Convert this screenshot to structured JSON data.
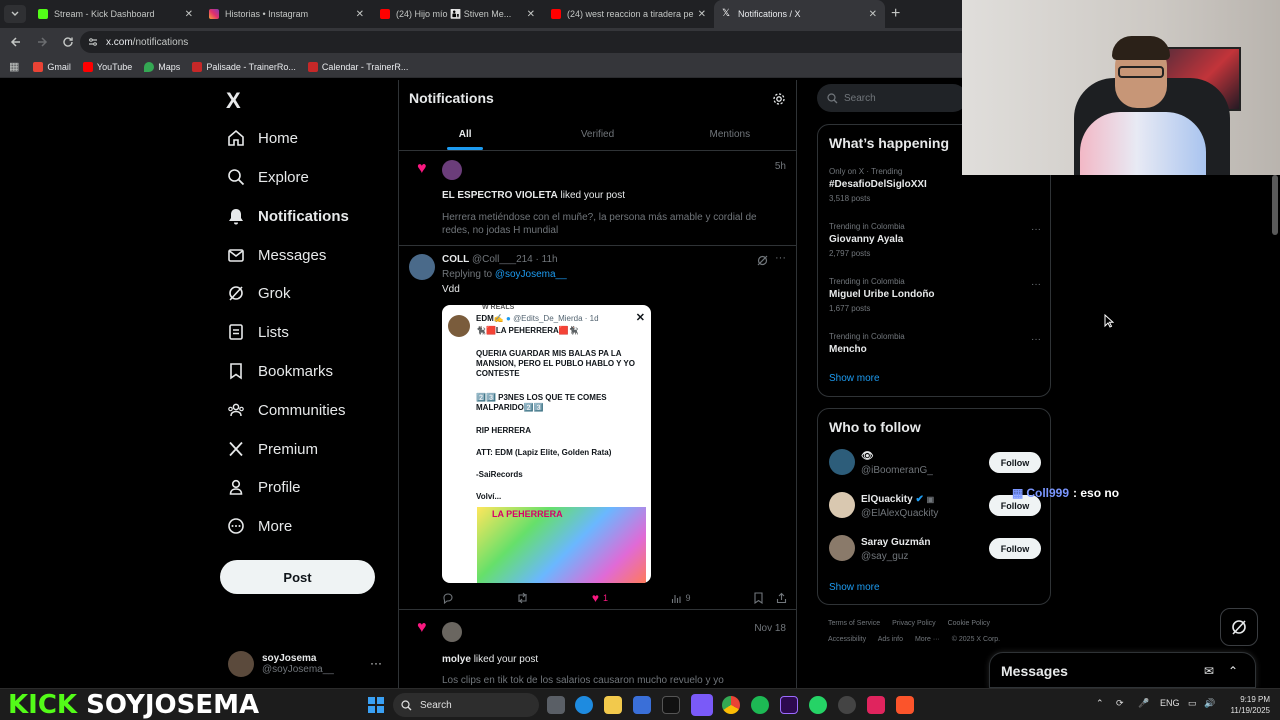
{
  "browser": {
    "tabs": [
      {
        "title": "Stream - Kick Dashboard",
        "favicon_color": "#53fc18",
        "active": false
      },
      {
        "title": "Historias • Instagram",
        "favicon_color": "#e1306c",
        "active": false
      },
      {
        "title": "(24) Hijo mío 👨‍👦 Stiven Me...",
        "favicon_color": "#ff0000",
        "active": false
      },
      {
        "title": "(24) west reaccion a tiradera pe...",
        "favicon_color": "#ff0000",
        "active": false
      },
      {
        "title": "Notifications / X",
        "favicon_color": "#ffffff",
        "active": true
      }
    ],
    "url_domain": "x.com",
    "url_path": "/notifications",
    "bookmarks": [
      {
        "label": "Gmail",
        "color": "#ea4335"
      },
      {
        "label": "YouTube",
        "color": "#ff0000"
      },
      {
        "label": "Maps",
        "color": "#34a853"
      },
      {
        "label": "Palisade - TrainerRo...",
        "color": "#c62828"
      },
      {
        "label": "Calendar - TrainerR...",
        "color": "#c62828"
      }
    ]
  },
  "nav": {
    "logo": "X",
    "items": [
      {
        "label": "Home",
        "icon": "home-icon"
      },
      {
        "label": "Explore",
        "icon": "search-icon"
      },
      {
        "label": "Notifications",
        "icon": "bell-icon"
      },
      {
        "label": "Messages",
        "icon": "mail-icon"
      },
      {
        "label": "Grok",
        "icon": "grok-icon"
      },
      {
        "label": "Lists",
        "icon": "list-icon"
      },
      {
        "label": "Bookmarks",
        "icon": "bookmark-icon"
      },
      {
        "label": "Communities",
        "icon": "people-icon"
      },
      {
        "label": "Premium",
        "icon": "x-icon"
      },
      {
        "label": "Profile",
        "icon": "user-icon"
      },
      {
        "label": "More",
        "icon": "more-circle-icon"
      }
    ],
    "post_button": "Post",
    "account": {
      "name": "soyJosema",
      "handle": "@soyJosema__"
    }
  },
  "main": {
    "title": "Notifications",
    "tabs": [
      "All",
      "Verified",
      "Mentions"
    ],
    "notif1": {
      "time": "5h",
      "actor": "EL ESPECTRO VIOLETA",
      "action": "liked your post",
      "text": "Herrera metiéndose con el muñe?, la persona más amable y cordial de redes, no jodas H mundial"
    },
    "tweet": {
      "name": "COLL",
      "handle": "@Coll___214 · 11h",
      "replying_prefix": "Replying to",
      "replying_to": "@soyJosema__",
      "body": "Vdd",
      "image": {
        "top_label": "W REALS",
        "author": "EDM✍️",
        "author_handle": "@Edits_De_Mierda · 1d",
        "title": "🐈‍⬛🟥LA PEHERRERA🟥🐈‍⬛",
        "line1": "QUERIA GUARDAR MIS BALAS PA LA MANSION, PERO EL PUBLO HABLO Y YO CONTESTE",
        "line2": "2️⃣3️⃣ P3NES LOS QUE TE COMES MALPARIDO2️⃣3️⃣",
        "line3": "RIP HERRERA",
        "line4": "ATT: EDM (Lapiz Elite, Golden Rata)",
        "line5": "-SaiRecords",
        "line6": "Volví...",
        "pic_text": "LA PEHERRERA"
      },
      "likes": "1",
      "views": "9"
    },
    "notif2": {
      "time": "Nov 18",
      "actor": "molye",
      "action": "liked your post",
      "text": "Los clips en tik tok de los salarios causaron mucho revuelo y yo"
    }
  },
  "sidebar": {
    "search_placeholder": "Search",
    "happening_title": "What’s happening",
    "trends": [
      {
        "meta": "Only on X · Trending",
        "name": "#DesafioDelSigloXXI",
        "count": "3,518 posts"
      },
      {
        "meta": "Trending in Colombia",
        "name": "Giovanny Ayala",
        "count": "2,797 posts"
      },
      {
        "meta": "Trending in Colombia",
        "name": "Miguel Uribe Londoño",
        "count": "1,677 posts"
      },
      {
        "meta": "Trending in Colombia",
        "name": "Mencho",
        "count": ""
      }
    ],
    "show_more": "Show more",
    "wtf_title": "Who to follow",
    "follow": [
      {
        "name": "👁",
        "handle": "@iBoomeranG_",
        "button": "Follow"
      },
      {
        "name": "ElQuackity",
        "handle": "@ElAlexQuackity",
        "button": "Follow"
      },
      {
        "name": "Saray Guzmán",
        "handle": "@say_guz",
        "button": "Follow"
      }
    ],
    "footer": [
      "Terms of Service",
      "Privacy Policy",
      "Cookie Policy",
      "Accessibility",
      "Ads info",
      "More ···",
      "© 2025 X Corp."
    ]
  },
  "overlay": {
    "chat_user": "Coll999",
    "chat_msg": ": eso no",
    "messages_title": "Messages",
    "stream_brand_1": "KICK",
    "stream_brand_2": "SOYJOSEMA"
  },
  "taskbar": {
    "search": "Search",
    "lang": "ENG",
    "time": "9:19 PM",
    "date": "11/19/2025"
  }
}
